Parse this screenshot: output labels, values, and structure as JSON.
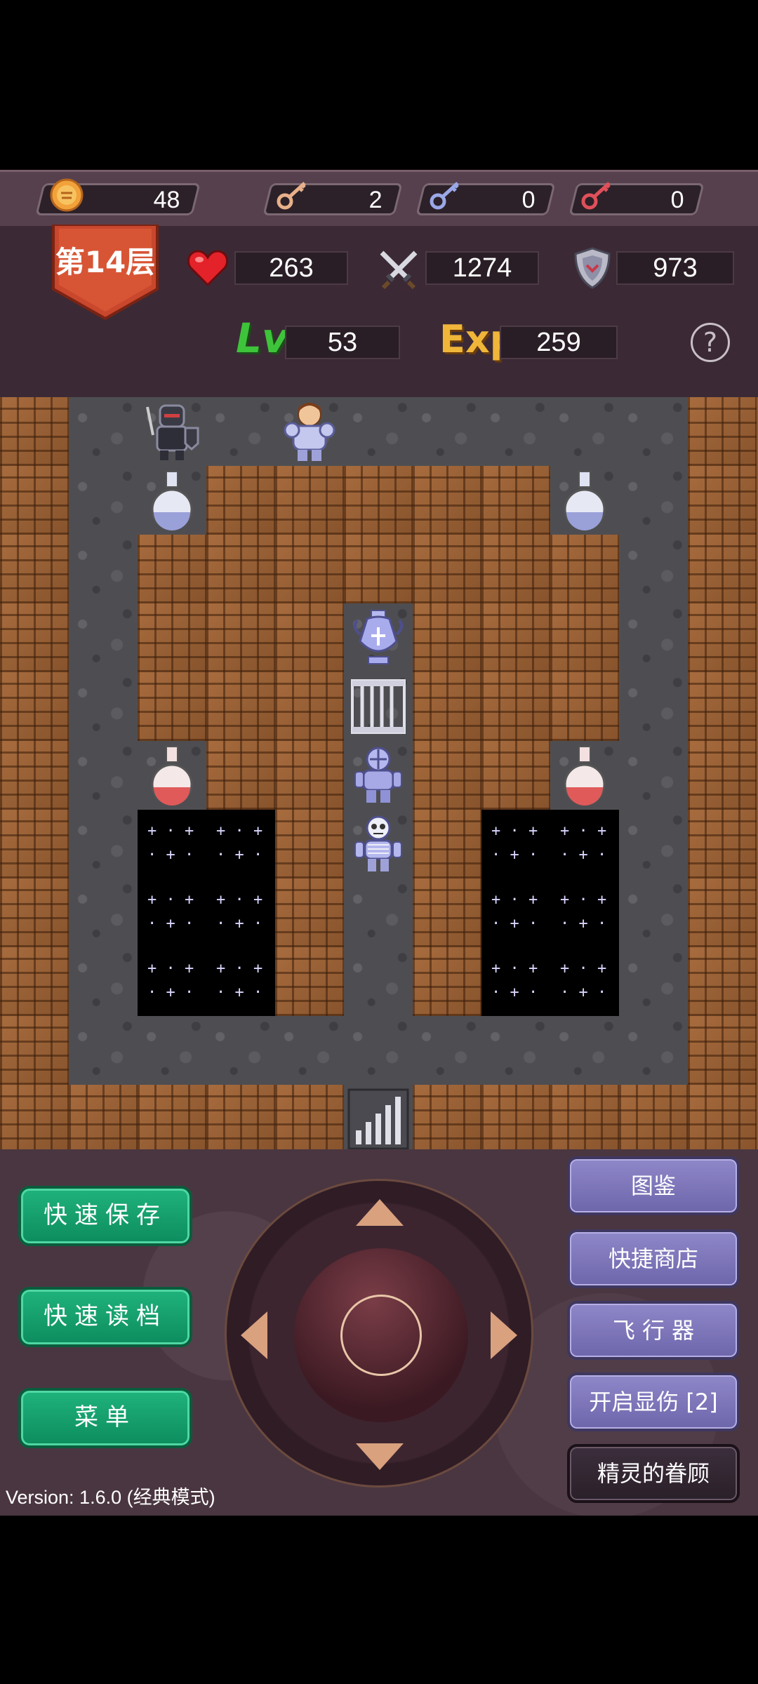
{
  "resources": {
    "gold": "48",
    "yellow_keys": "2",
    "blue_keys": "0",
    "red_keys": "0"
  },
  "stats": {
    "floor": "第14层",
    "hp": "263",
    "attack": "1274",
    "defense": "973",
    "level_label": "Lv",
    "level": "53",
    "exp_label": "Exp",
    "exp": "259",
    "help": "?"
  },
  "controls": {
    "quick_save": "快速保存",
    "quick_load": "快速读档",
    "menu": "菜单",
    "monster_manual": "图鉴",
    "quick_shop": "快捷商店",
    "flyer": "飞 行 器",
    "show_damage": "开启显伤 [2]",
    "fairy_blessing": "精灵的眷顾"
  },
  "version": "Version: 1.6.0 (经典模式)",
  "colors": {
    "gold": "#f2a23a",
    "yellow_key": "#e8b08a",
    "blue_key": "#9aa8e8",
    "red_key": "#e0505a",
    "green_button": "#12a06a",
    "purple_button": "#7d76bb"
  }
}
